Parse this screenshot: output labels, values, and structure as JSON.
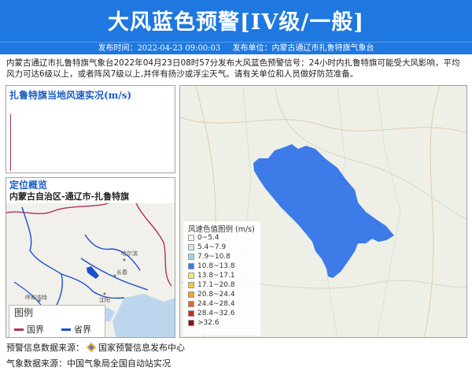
{
  "header": {
    "title": "大风蓝色预警[IV级/一般]",
    "publish_time": "发布时间：2022-04-23 09:00:03",
    "publish_unit": "发布单位：内蒙古通辽市扎鲁特旗气象台"
  },
  "description": "内蒙古通辽市扎鲁特旗气象台2022年04月23日08时57分发布大风蓝色预警信号：24小时内扎鲁特旗可能受大风影响，平均风力可达6级以上，或者阵风7级以上,并伴有扬沙或浮尘天气。请有关单位和人员做好防范准备。",
  "chart_panel": {
    "title": "扎鲁特旗当地风速实况(m/s)"
  },
  "location_panel": {
    "title": "定位概览",
    "subtitle": "内蒙古自治区-通辽市-扎鲁特旗",
    "city_labels": [
      "哈尔滨",
      "长春",
      "呼和浩特",
      "沈阳"
    ],
    "legend": {
      "title": "图例",
      "national_border": "国界",
      "province_border": "省界",
      "national_color": "#b03060",
      "province_color": "#1a4fd0"
    }
  },
  "main_map": {
    "region_color": "#3c7be8",
    "legend_title": "风速色值图例 (m/s)",
    "legend_items": [
      {
        "label": "0~5.4",
        "color": "#f2f2f2"
      },
      {
        "label": "5.4~7.9",
        "color": "#cfe6f7"
      },
      {
        "label": "7.9~10.8",
        "color": "#a3d0f0"
      },
      {
        "label": "10.8~13.8",
        "color": "#3c7be8"
      },
      {
        "label": "13.8~17.1",
        "color": "#f5e96a"
      },
      {
        "label": "17.1~20.8",
        "color": "#f2c443"
      },
      {
        "label": "20.8~24.4",
        "color": "#f0a330"
      },
      {
        "label": "24.4~28.4",
        "color": "#e8642a"
      },
      {
        "label": "28.4~32.6",
        "color": "#cc2a1e"
      },
      {
        "label": ">32.6",
        "color": "#8c0f12"
      }
    ]
  },
  "footer": {
    "warning_source": "预警信息数据来源：",
    "warning_source_org": "国家预警信息发布中心",
    "weather_source": "气象数据来源：中国气象局全国自动站实况"
  }
}
